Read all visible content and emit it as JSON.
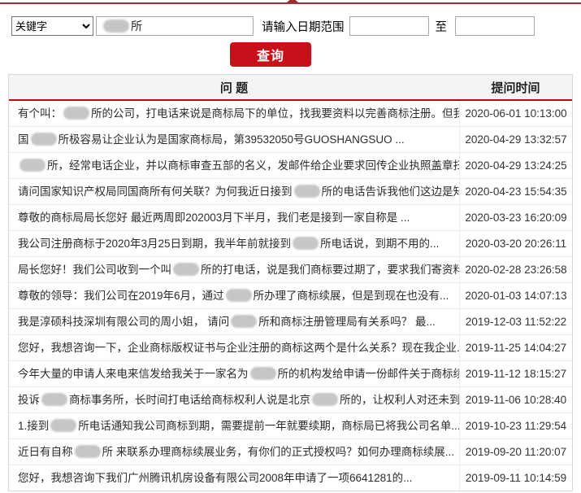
{
  "search_form": {
    "field_type_select": {
      "selected": "关键字",
      "options": [
        "关键字"
      ]
    },
    "keyword_input": {
      "parts": [
        {
          "blur": 2
        },
        {
          "text": "所"
        }
      ]
    },
    "date_range_label": "请输入日期范围",
    "date_from": {
      "value": ""
    },
    "range_separator_label": "至",
    "date_to": {
      "value": ""
    },
    "search_button_label": "查询"
  },
  "table": {
    "headers": {
      "question": "问 题",
      "time": "提问时间"
    },
    "rows": [
      {
        "parts": [
          {
            "text": "有个叫："
          },
          {
            "blur": 2
          },
          {
            "text": "所的公司，打电话来说是商标局下的单位，找我要资料以完善商标注册。但我..."
          }
        ],
        "time": "2020-06-01 10:13:00"
      },
      {
        "parts": [
          {
            "text": "国"
          },
          {
            "blur": 2
          },
          {
            "text": "所极容易让企业认为是国家商标局，第39532050号GUOSHANGSUO ..."
          }
        ],
        "time": "2020-04-29 13:32:57"
      },
      {
        "parts": [
          {
            "blur": 2
          },
          {
            "text": "所，经常电话企业，并以商标审查五部的名义，发邮件给企业要求回传企业执照盖章扫..."
          }
        ],
        "time": "2020-04-29 13:24:25"
      },
      {
        "parts": [
          {
            "text": "请问国家知识产权局同国商所有何关联？为何我近日接到"
          },
          {
            "blur": 2
          },
          {
            "text": "所的电话告诉我他们这边是知..."
          }
        ],
        "time": "2020-04-23 15:54:35"
      },
      {
        "parts": [
          {
            "text": "尊敬的商标局局长您好 最近两周即202003月下半月，我们老是接到一家自称是 ..."
          }
        ],
        "time": "2020-03-23 16:20:09"
      },
      {
        "parts": [
          {
            "text": "我公司注册商标于2020年3月25日到期，我半年前就接到"
          },
          {
            "blur": 2
          },
          {
            "text": "所电话说，到期不用的..."
          }
        ],
        "time": "2020-03-20 20:26:11"
      },
      {
        "parts": [
          {
            "text": "局长您好！我们公司收到一个叫"
          },
          {
            "blur": 2
          },
          {
            "text": "所的打电话，说是我们商标要过期了，要求我们寄资料..."
          }
        ],
        "time": "2020-02-28 23:26:58"
      },
      {
        "parts": [
          {
            "text": "尊敬的领导：我们公司在2019年6月，通过"
          },
          {
            "blur": 2
          },
          {
            "text": "所办理了商标续展，但是到现在也没有..."
          }
        ],
        "time": "2020-01-03 14:07:13"
      },
      {
        "parts": [
          {
            "text": "我是淳硕科技深圳有限公司的周小姐， 请问"
          },
          {
            "blur": 2
          },
          {
            "text": "所和商标注册管理局有关系吗？ 最..."
          }
        ],
        "time": "2019-12-03 11:52:22"
      },
      {
        "parts": [
          {
            "text": "您好，我想咨询一下，企业商标版权证书与企业注册的商标这两个是什么关系？现在我企业..."
          }
        ],
        "time": "2019-11-25 14:04:27"
      },
      {
        "parts": [
          {
            "text": "今年大量的申请人来电来信发给我关于一家名为"
          },
          {
            "blur": 2
          },
          {
            "text": "所的机构发给申请一份邮件关于商标续..."
          }
        ],
        "time": "2019-11-12 18:15:27"
      },
      {
        "parts": [
          {
            "text": "投诉"
          },
          {
            "blur": 2
          },
          {
            "text": "商标事务所，长时间打电话给商标权利人说是北京"
          },
          {
            "blur": 2
          },
          {
            "text": "所的，让权利人对还未到续..."
          }
        ],
        "time": "2019-11-06 10:28:40"
      },
      {
        "parts": [
          {
            "text": "1.接到"
          },
          {
            "blur": 2
          },
          {
            "text": "所电话通知我公司商标到期，需要提前一年就要续期，商标局已将我公司名单..."
          }
        ],
        "time": "2019-10-23 11:29:54"
      },
      {
        "parts": [
          {
            "text": "近日有自称"
          },
          {
            "blur": 2
          },
          {
            "text": "所 来联系办理商标续展业务，有你们的正式授权吗？如何办理商标续展..."
          }
        ],
        "time": "2019-09-20 11:20:07"
      },
      {
        "parts": [
          {
            "text": "您好，我想咨询下我们广州腾讯机房设备有限公司2008年申请了一项6641281的..."
          }
        ],
        "time": "2019-09-11 10:14:59"
      }
    ]
  },
  "colors": {
    "accent_red": "#c9101a",
    "top_line_red": "#9e2f36",
    "header_underline_red": "#ae0d14",
    "header_bg": "#f4f4f4",
    "text": "#2b2b2b",
    "table_border": "#d9d9d9",
    "row_divider": "#e9e9e9",
    "redaction_gray": "#c6c6c6"
  }
}
